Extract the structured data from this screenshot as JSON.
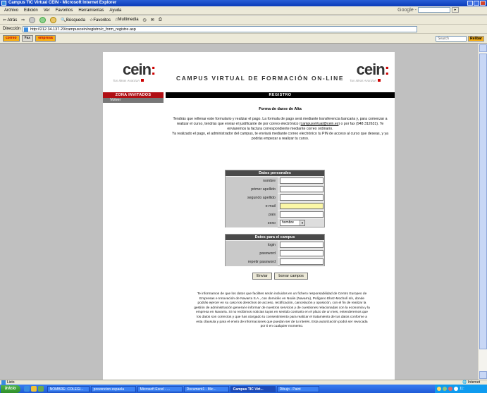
{
  "window": {
    "title": "Campus TIC Virtual CEIN - Microsoft Internet Explorer"
  },
  "menu": [
    "Archivo",
    "Edición",
    "Ver",
    "Favoritos",
    "Herramientas",
    "Ayuda"
  ],
  "google": {
    "label": "Google -"
  },
  "toolbar": {
    "back": "Atrás",
    "search": "Búsqueda",
    "favorites": "Favoritos",
    "multimedia": "Multimedia"
  },
  "address": {
    "label": "Dirección",
    "url": "http://212.34.137.20/campuscein/registro/c_form_registre.asp"
  },
  "links": {
    "btn1": "correo",
    "btn2": "Fax",
    "btn3": "empresa",
    "search_placeholder": "Search",
    "search_btn": "Rellbar"
  },
  "page": {
    "logo": "cein",
    "logo_tagline": "Tus Ideas Avanzan",
    "campus_title": "CAMPUS VIRTUAL DE FORMACIÓN ON-LINE",
    "nav_zone": "ZONA INVITADOS",
    "nav_volver": "Volver",
    "registro": "REGISTRO",
    "forma_title": "Forma de darse de Alta",
    "intro_1": "Tendrás que rellenar este formulario y realizar el pago. La formula de pago será mediante transferencia bancaria y, para comenzar a realizar el curso, tendrás que enviar el justificante de por correo electrónico",
    "intro_mail": "campusvirtual@cein.es",
    "intro_2": ") o por fax (948 312631). Te enviaremos la factura correspondiente mediante correo ordinario.",
    "intro_3": "Ya realizado el pago, el administrador del campus, te enviará mediante correo electrónico tu PIN de acceso al curso que deseas, y ya podrás empezar a realizar tu curso.",
    "personal": {
      "title": "Datos personales",
      "labels": [
        "nombre",
        "primer apellido",
        "segundo apellido",
        "e-mail",
        "pais",
        "sexo"
      ],
      "sexo_value": "hombre"
    },
    "campus": {
      "title": "Datos para el campus",
      "labels": [
        "login",
        "password",
        "repetir password"
      ]
    },
    "buttons": {
      "send": "Enviar",
      "clear": "borrar campos"
    },
    "legal": "Te informamos de que los datos que facilites serán incluidos en un fichero responsabilidad de Centro Europeo de Empresas e Innovación de Navarra S.A., con domicilio en Noáin (Navarra), Polígono Elorz-Mocholí s/n, donde podrás ejercer en su caso los derechos de acceso, rectificación, cancelación y oposición, con el fin de realizar la gestión de administración general e informar de nuestros servicios y de cuestiones relacionadas con la economía y la empresa en Navarra. Si no recibimos noticias tuyas en sentido contrario en el plazo de un mes, entenderemos que los datos son correctos y que has otorgado tu consentimiento para realizar el tratamiento de tus datos conforme a esta cláusula y para el envío de informaciones que puedan ser de tu interés. Esta autorización podrá ser revocada por ti en cualquier momento."
  },
  "status": {
    "left": "Listo",
    "zone": "Internet"
  },
  "taskbar": {
    "start": "Inicio",
    "tasks": [
      "NOMBRE: COLEGI...",
      "prevencion espaela",
      "Microsoft Excel - ...",
      "Document1 - Mic...",
      "Campus TIC Virt...",
      "Dibujo - Paint"
    ],
    "clock": "11:"
  },
  "colors": {
    "accent_red": "#b00f14",
    "title_blue": "#0a3bb8",
    "input_yellow": "#fbf7a6"
  }
}
